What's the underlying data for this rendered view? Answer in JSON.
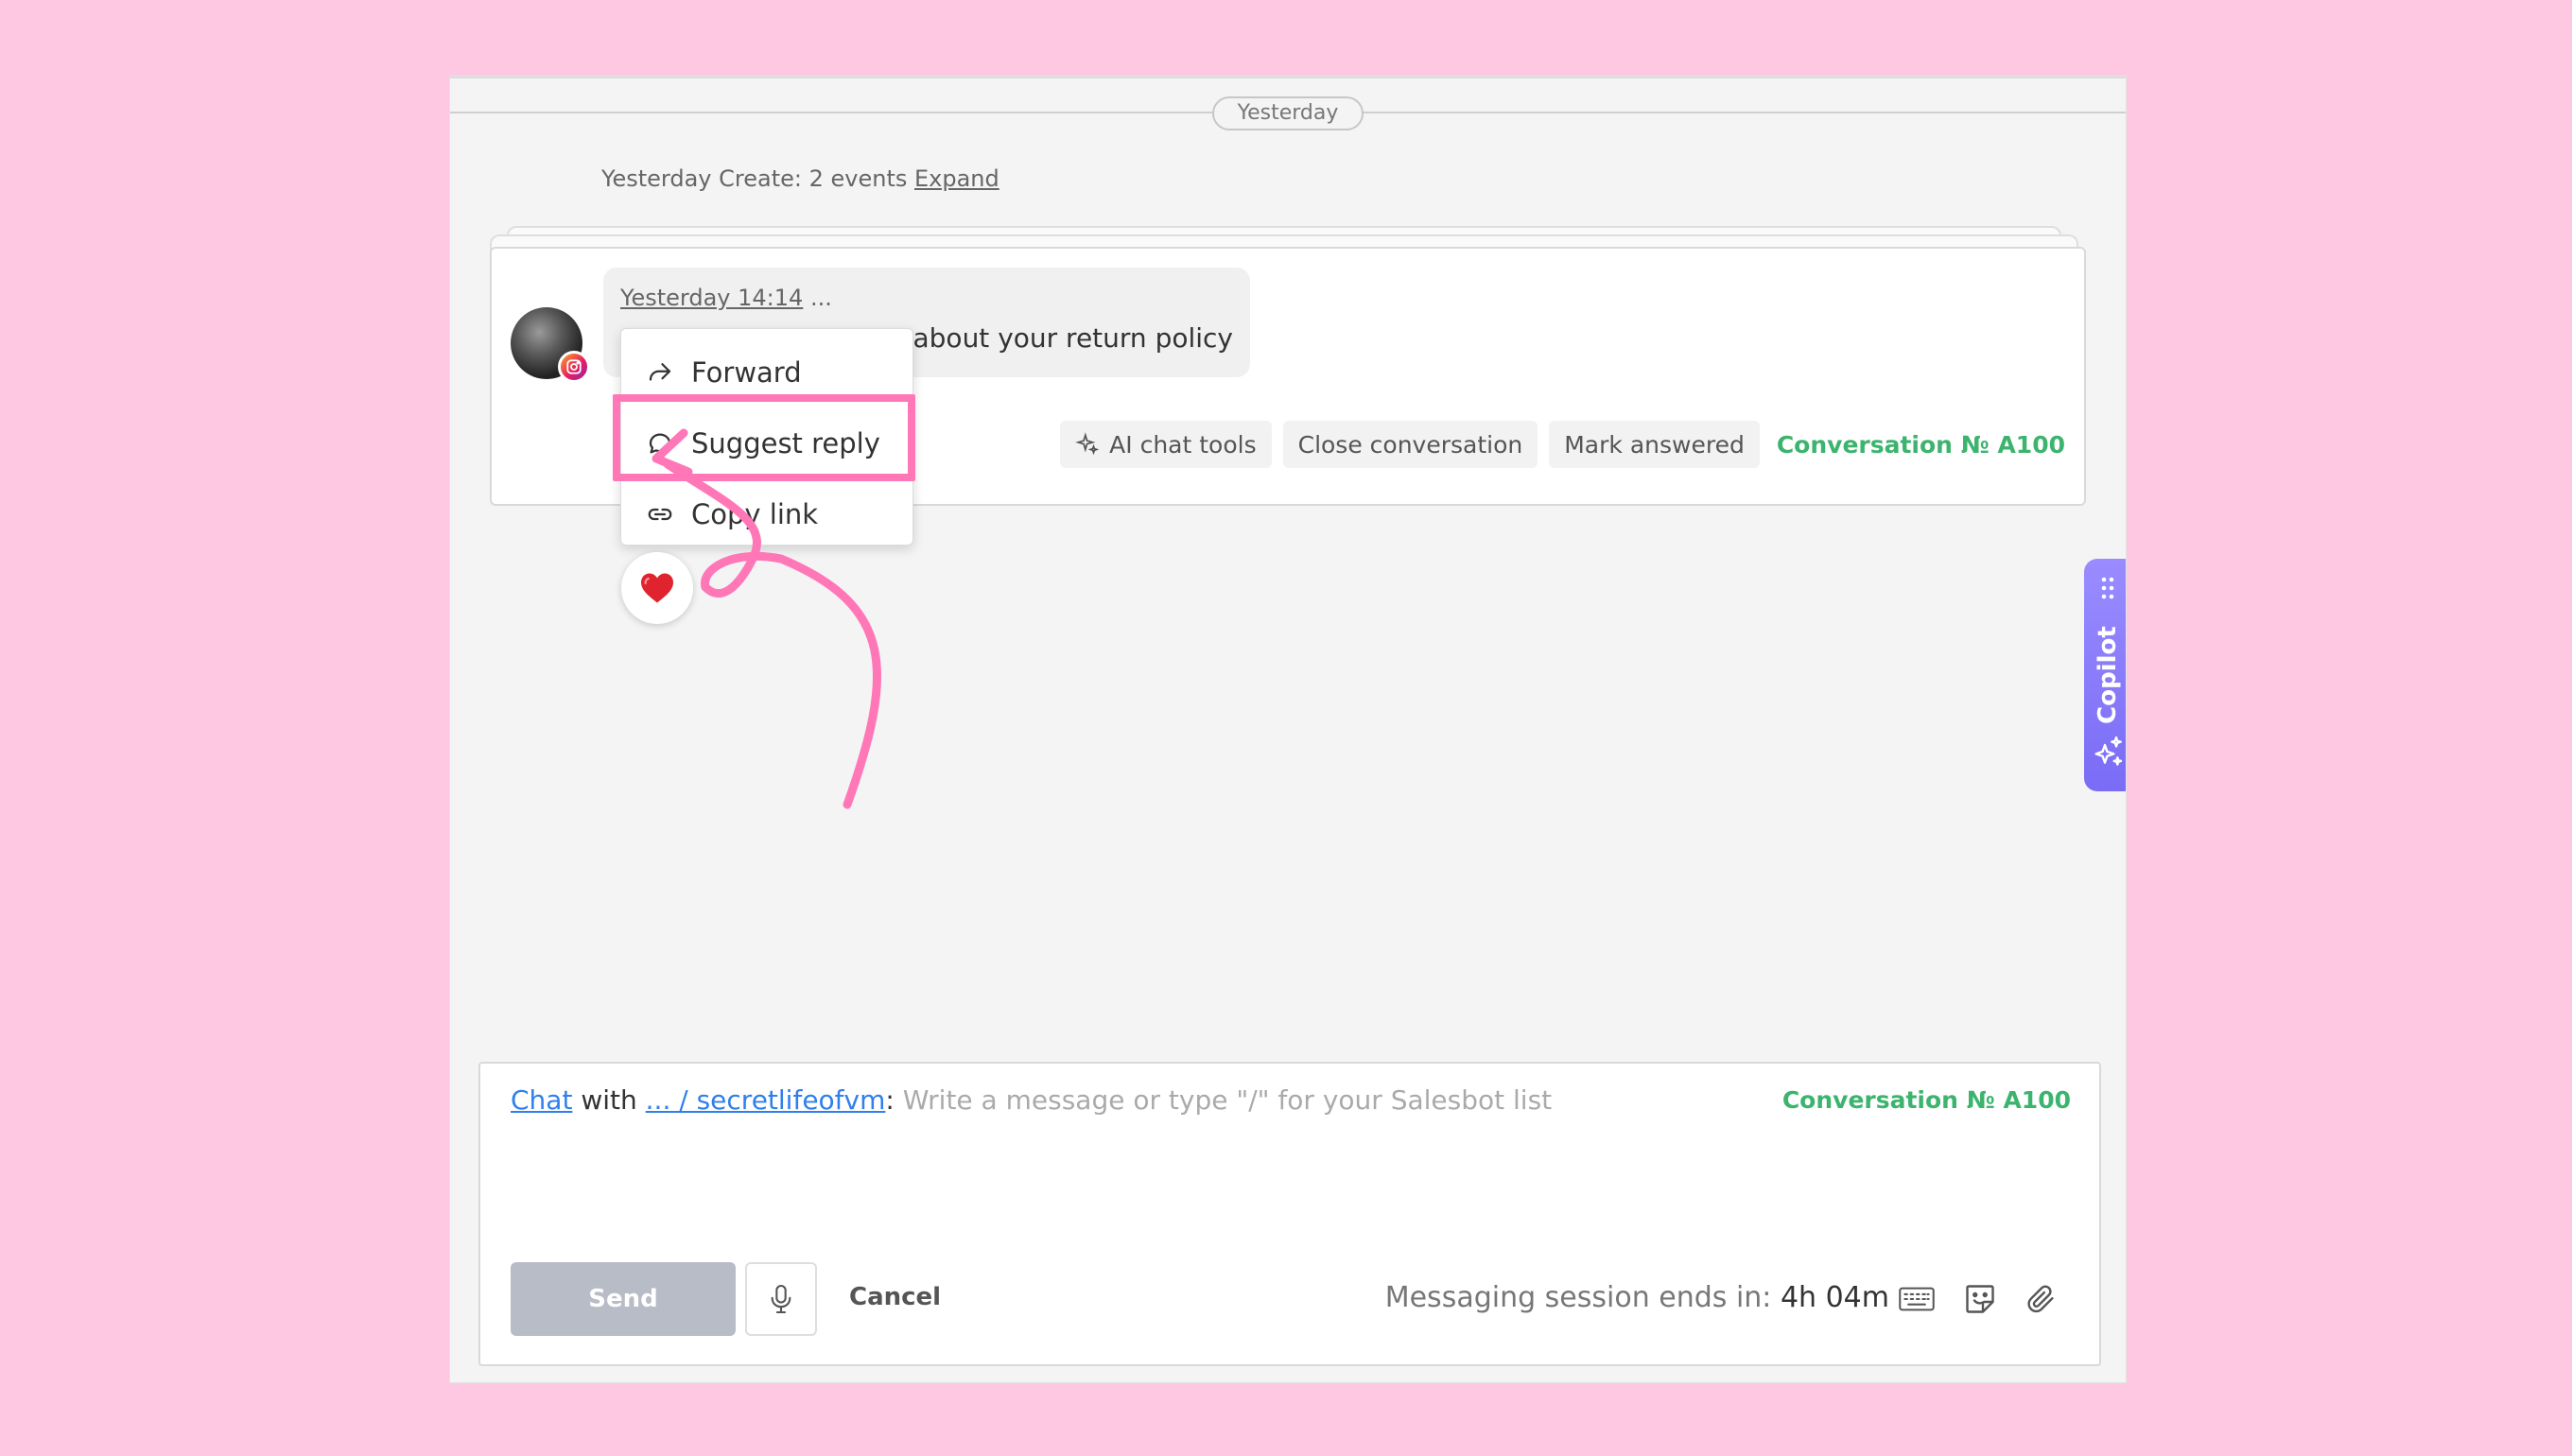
{
  "timeline": {
    "day_divider": "Yesterday",
    "events_text": "Yesterday Create: 2 events",
    "expand_link": "Expand"
  },
  "message": {
    "timestamp": "Yesterday 14:14",
    "more": "...",
    "text_visible": "e about your return policy",
    "source_icon": "instagram-icon"
  },
  "context_menu": {
    "items": [
      {
        "label": "Forward",
        "icon": "forward-icon"
      },
      {
        "label": "Suggest reply",
        "icon": "chat-bubble-icon"
      },
      {
        "label": "Copy link",
        "icon": "link-icon"
      }
    ],
    "highlighted_item": "Suggest reply"
  },
  "reaction": {
    "emoji": "❤️"
  },
  "toolbar": {
    "ai_tools": "AI chat tools",
    "close_conversation": "Close conversation",
    "mark_answered": "Mark answered",
    "conversation_number": "Conversation № A100"
  },
  "copilot": {
    "label": "Copilot"
  },
  "composer": {
    "chat_link": "Chat",
    "with_text": "with",
    "contact_link": "... / secretlifeofvm",
    "colon": ":",
    "placeholder": "Write a message or type \"/\" for your Salesbot list",
    "conversation_number": "Conversation № A100",
    "send_label": "Send",
    "cancel_label": "Cancel",
    "session_label": "Messaging session ends in:",
    "session_value": "4h 04m"
  },
  "colors": {
    "background": "#ffc8e2",
    "accent_green": "#3cb46e",
    "link_blue": "#2f80ed",
    "highlight_pink": "#ff77b6",
    "copilot_purple": "#8a7cf8"
  }
}
